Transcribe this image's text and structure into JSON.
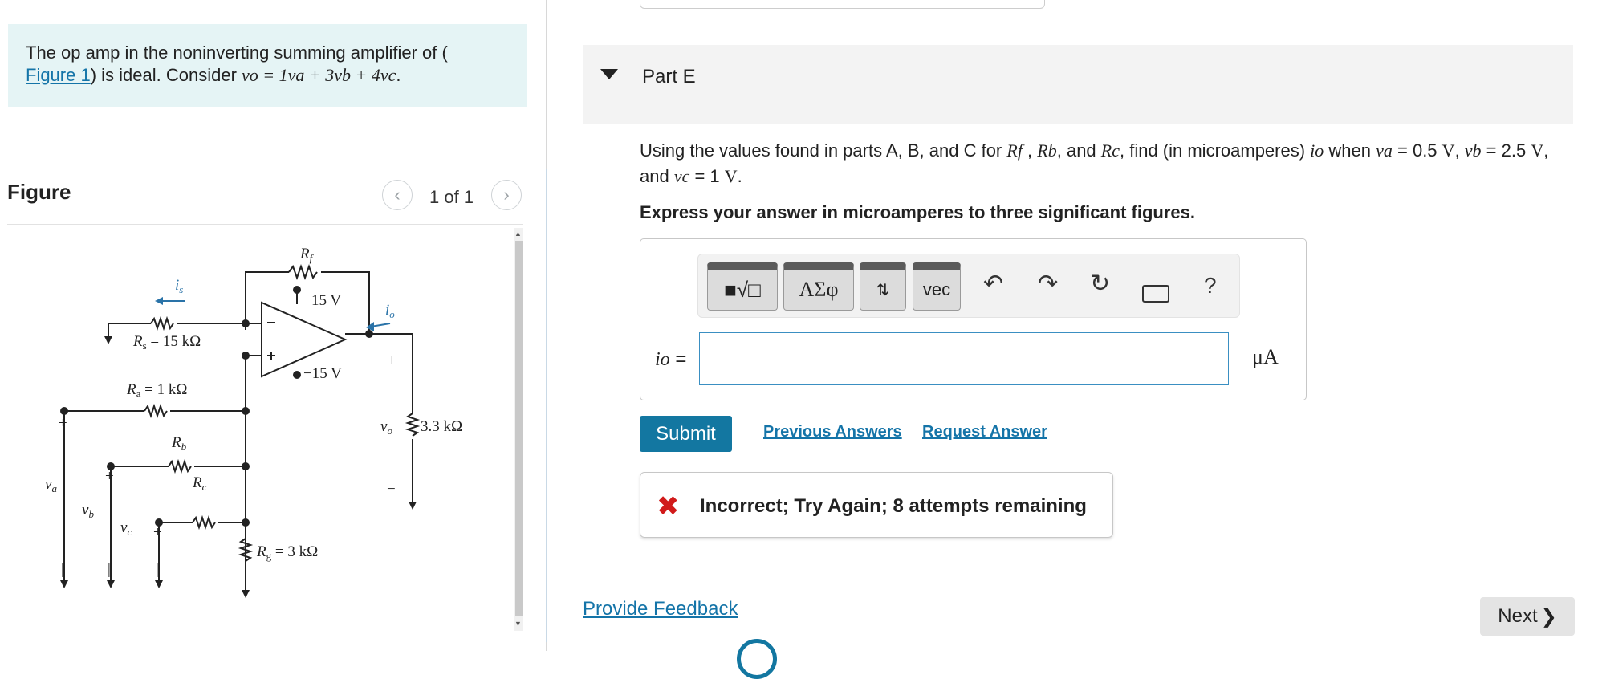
{
  "problem": {
    "intro_text_1": "The op amp in the noninverting summing amplifier of (",
    "figure_link": "Figure 1",
    "intro_text_2": ") is ideal. Consider ",
    "equation_math": "vo = 1va + 3vb + 4vc",
    "equation_end": "."
  },
  "figure": {
    "title": "Figure",
    "count": "1 of 1",
    "prev_icon": "chevron-left-icon",
    "next_icon": "chevron-right-icon",
    "circuit": {
      "Rf": "R",
      "Rf_sub": "f",
      "is": "i",
      "is_sub": "s",
      "io": "i",
      "io_sub": "o",
      "Rs": "R",
      "Rs_sub": "s",
      "Rs_val": "= 15 kΩ",
      "Ra": "R",
      "Ra_sub": "a",
      "Ra_val": "= 1 kΩ",
      "Rb": "R",
      "Rb_sub": "b",
      "Rc": "R",
      "Rc_sub": "c",
      "Rg": "R",
      "Rg_sub": "g",
      "Rg_val": "= 3 kΩ",
      "vplus": "15 V",
      "vminus": "−15 V",
      "load": "3.3 kΩ",
      "vo": "v",
      "vo_sub": "o",
      "va": "v",
      "va_sub": "a",
      "vb": "v",
      "vb_sub": "b",
      "vc": "v",
      "vc_sub": "c",
      "plus": "+",
      "minus": "−",
      "bar": "|"
    }
  },
  "part": {
    "title": "Part E",
    "question_1": "Using the values found in parts A, B, and C for ",
    "question_Rf": "Rf",
    "question_sep1": " , ",
    "question_Rb": "Rb",
    "question_sep2": ", and ",
    "question_Rc": "Rc",
    "question_2": ", find (in microamperes) ",
    "question_io": "io",
    "question_3": " when ",
    "question_va": "va",
    "question_4": " = 0.5 ",
    "question_V1": "V",
    "question_5": ", ",
    "question_vb": "vb",
    "question_6": " = 2.5 ",
    "question_V2": "V",
    "question_7": ", and ",
    "question_vc": "vc",
    "question_8": " = 1 ",
    "question_V3": "V",
    "question_9": ".",
    "instruction": "Express your answer in microamperes to three significant figures."
  },
  "toolbar": {
    "templates_icon": "fraction-sqrt-template-icon",
    "greek_label": "ΑΣφ",
    "arrows_icon": "subscript-superscript-icon",
    "vec_label": "vec",
    "undo_icon": "undo-icon",
    "redo_icon": "redo-icon",
    "reset_icon": "reset-icon",
    "keyboard_icon": "keyboard-icon",
    "help_label": "?"
  },
  "answer": {
    "label": "io",
    "equals": " =",
    "value": "",
    "unit": "μA"
  },
  "actions": {
    "submit": "Submit",
    "previous_answers": "Previous Answers",
    "request_answer": "Request Answer"
  },
  "feedback": {
    "icon": "x-mark-icon",
    "text": "Incorrect; Try Again; 8 attempts remaining"
  },
  "footer": {
    "provide_feedback": "Provide Feedback",
    "next": "Next"
  },
  "colors": {
    "accent": "#1377a1",
    "link": "#1474a8",
    "intro_bg": "#e5f4f5",
    "error": "#d11a1a"
  }
}
